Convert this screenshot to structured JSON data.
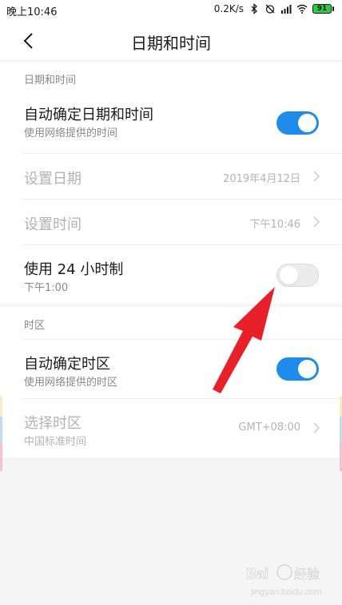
{
  "status_bar": {
    "time": "晚上10:46",
    "speed": "0.2K/s",
    "battery": "91",
    "icons": [
      "bluetooth-icon",
      "alarm-off-icon",
      "signal-icon",
      "wifi-icon",
      "battery-icon"
    ]
  },
  "header": {
    "title": "日期和时间",
    "back_icon": "chevron-left-icon"
  },
  "sections": {
    "datetime": {
      "header": "日期和时间",
      "auto": {
        "label": "自动确定日期和时间",
        "sub": "使用网络提供的时间",
        "enabled": true
      },
      "set_date": {
        "label": "设置日期",
        "value": "2019年4月12日"
      },
      "set_time": {
        "label": "设置时间",
        "value": "下午10:46"
      },
      "format24": {
        "label": "使用 24 小时制",
        "sub": "下午1:00",
        "enabled": false
      }
    },
    "timezone": {
      "header": "时区",
      "auto": {
        "label": "自动确定时区",
        "sub": "使用网络提供的时区",
        "enabled": true
      },
      "select": {
        "label": "选择时区",
        "sub": "中国标准时间",
        "value": "GMT+08:00"
      }
    }
  },
  "colors": {
    "accent": "#1f8ceb",
    "annotation_arrow": "#e8202a",
    "background": "#f5f5f5"
  },
  "watermark": "Baidu 经验 jingyan.baidu.com"
}
